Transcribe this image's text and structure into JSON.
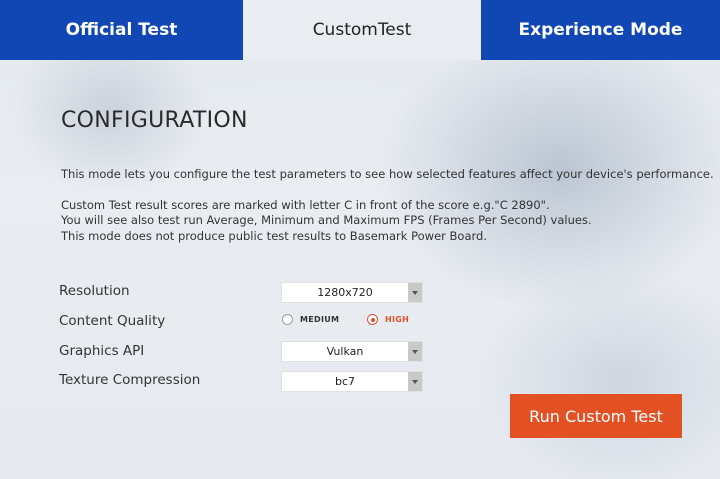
{
  "tabs": {
    "official": "Official Test",
    "custom": "CustomTest",
    "experience": "Experience Mode"
  },
  "config": {
    "title": "CONFIGURATION",
    "description": [
      "This mode lets you configure the test parameters to see how selected features affect your device's performance.",
      "Custom Test result scores are marked with letter C in front of the score e.g.\"C 2890\".",
      "You will see also test run Average, Minimum and Maximum FPS (Frames Per Second) values.",
      "This mode does not produce public test results to Basemark Power Board."
    ]
  },
  "settings": {
    "resolution": {
      "label": "Resolution",
      "value": "1280x720"
    },
    "content_quality": {
      "label": "Content Quality",
      "options": [
        "MEDIUM",
        "HIGH"
      ],
      "selected": "HIGH"
    },
    "graphics_api": {
      "label": "Graphics API",
      "value": "Vulkan"
    },
    "texture_compression": {
      "label": "Texture Compression",
      "value": "bc7"
    }
  },
  "run_button": "Run Custom Test",
  "colors": {
    "tab_blue": "#1147b5",
    "accent_orange": "#e35024",
    "radio_selected": "#e0532d"
  }
}
